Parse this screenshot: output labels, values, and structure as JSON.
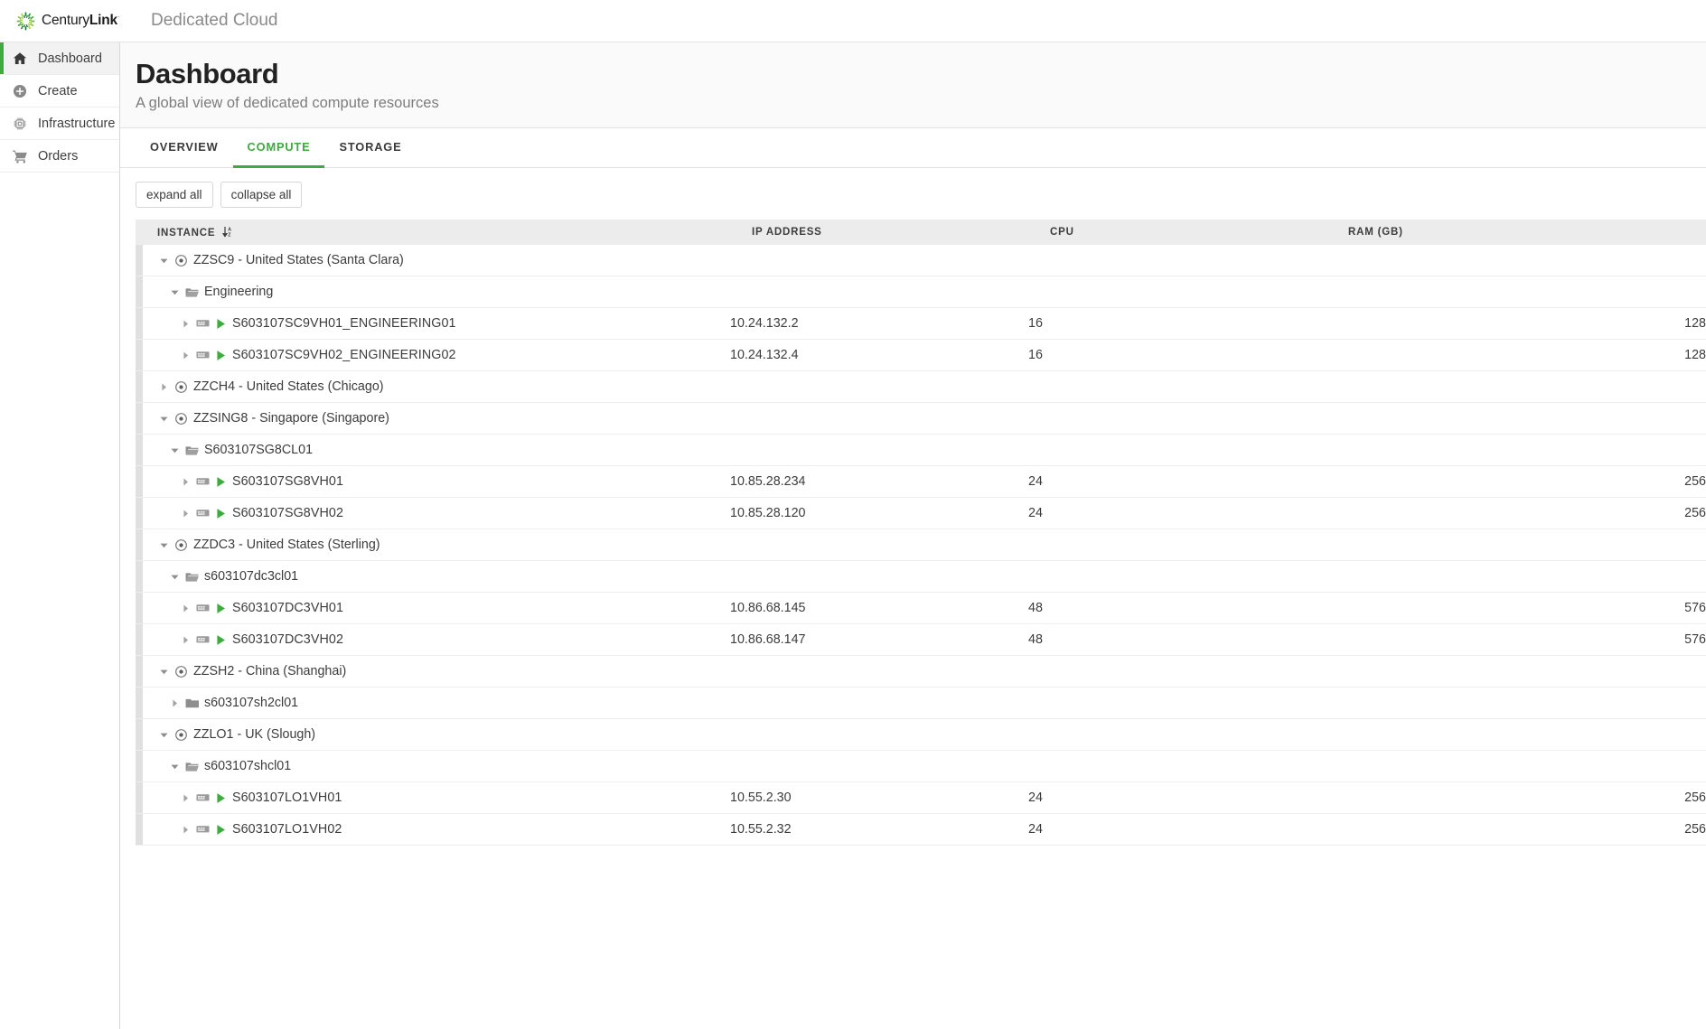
{
  "brand": {
    "name_light": "Century",
    "name_bold": "Link",
    "registered": "·",
    "logo_icon": "centurylink-burst-icon",
    "app_title": "Dedicated Cloud",
    "accent_green": "#3eab3e",
    "logo_green_dark": "#1a7a33",
    "logo_green_mid": "#4aa83c",
    "logo_green_light": "#8cc63f"
  },
  "sidebar": {
    "items": [
      {
        "label": "Dashboard",
        "icon": "home-icon",
        "active": true
      },
      {
        "label": "Create",
        "icon": "plus-circle-icon",
        "active": false
      },
      {
        "label": "Infrastructure",
        "icon": "chip-icon",
        "active": false
      },
      {
        "label": "Orders",
        "icon": "cart-icon",
        "active": false
      }
    ]
  },
  "page": {
    "title": "Dashboard",
    "subtitle": "A global view of dedicated compute resources"
  },
  "tabs": [
    {
      "label": "OVERVIEW",
      "active": false
    },
    {
      "label": "COMPUTE",
      "active": true
    },
    {
      "label": "STORAGE",
      "active": false
    }
  ],
  "toolbar": {
    "expand_all_label": "expand all",
    "collapse_all_label": "collapse all"
  },
  "table": {
    "columns": {
      "instance": "INSTANCE",
      "instance_sort_icon": "sort-az-descending-icon",
      "ip_address": "IP ADDRESS",
      "cpu": "CPU",
      "ram": "RAM (GB)"
    },
    "rows": [
      {
        "level": 0,
        "type": "datacenter",
        "expanded": true,
        "icon": "target-circle-icon",
        "label": "ZZSC9 - United States (Santa Clara)",
        "ip": "",
        "cpu": "",
        "ram": "",
        "gutter": "dark"
      },
      {
        "level": 1,
        "type": "folder",
        "expanded": true,
        "icon": "folder-open-icon",
        "label": "Engineering",
        "ip": "",
        "cpu": "",
        "ram": "",
        "gutter": "dark"
      },
      {
        "level": 2,
        "type": "server",
        "expanded": false,
        "icon": "server-icon",
        "status_icon": "play-running-icon",
        "label": "S603107SC9VH01_ENGINEERING01",
        "ip": "10.24.132.2",
        "cpu": "16",
        "ram": "128",
        "gutter": "dark"
      },
      {
        "level": 2,
        "type": "server",
        "expanded": false,
        "icon": "server-icon",
        "status_icon": "play-running-icon",
        "label": "S603107SC9VH02_ENGINEERING02",
        "ip": "10.24.132.4",
        "cpu": "16",
        "ram": "128",
        "gutter": "dark"
      },
      {
        "level": 0,
        "type": "datacenter",
        "expanded": false,
        "icon": "target-circle-icon",
        "label": "ZZCH4 - United States (Chicago)",
        "ip": "",
        "cpu": "",
        "ram": "",
        "gutter": "dark"
      },
      {
        "level": 0,
        "type": "datacenter",
        "expanded": true,
        "icon": "target-circle-icon",
        "label": "ZZSING8 - Singapore (Singapore)",
        "ip": "",
        "cpu": "",
        "ram": "",
        "gutter": "dark"
      },
      {
        "level": 1,
        "type": "folder",
        "expanded": true,
        "icon": "folder-open-icon",
        "label": "S603107SG8CL01",
        "ip": "",
        "cpu": "",
        "ram": "",
        "gutter": "dark"
      },
      {
        "level": 2,
        "type": "server",
        "expanded": false,
        "icon": "server-icon",
        "status_icon": "play-running-icon",
        "label": "S603107SG8VH01",
        "ip": "10.85.28.234",
        "cpu": "24",
        "ram": "256",
        "gutter": "dark"
      },
      {
        "level": 2,
        "type": "server",
        "expanded": false,
        "icon": "server-icon",
        "status_icon": "play-running-icon",
        "label": "S603107SG8VH02",
        "ip": "10.85.28.120",
        "cpu": "24",
        "ram": "256",
        "gutter": "dark"
      },
      {
        "level": 0,
        "type": "datacenter",
        "expanded": true,
        "icon": "target-circle-icon",
        "label": "ZZDC3 - United States (Sterling)",
        "ip": "",
        "cpu": "",
        "ram": "",
        "gutter": "dark"
      },
      {
        "level": 1,
        "type": "folder",
        "expanded": true,
        "icon": "folder-open-icon",
        "label": "s603107dc3cl01",
        "ip": "",
        "cpu": "",
        "ram": "",
        "gutter": "dark"
      },
      {
        "level": 2,
        "type": "server",
        "expanded": false,
        "icon": "server-icon",
        "status_icon": "play-running-icon",
        "label": "S603107DC3VH01",
        "ip": "10.86.68.145",
        "cpu": "48",
        "ram": "576",
        "gutter": "dark"
      },
      {
        "level": 2,
        "type": "server",
        "expanded": false,
        "icon": "server-icon",
        "status_icon": "play-running-icon",
        "label": "S603107DC3VH02",
        "ip": "10.86.68.147",
        "cpu": "48",
        "ram": "576",
        "gutter": "dark"
      },
      {
        "level": 0,
        "type": "datacenter",
        "expanded": true,
        "icon": "target-circle-icon",
        "label": "ZZSH2 - China (Shanghai)",
        "ip": "",
        "cpu": "",
        "ram": "",
        "gutter": "dark"
      },
      {
        "level": 1,
        "type": "folder",
        "expanded": false,
        "icon": "folder-closed-icon",
        "label": "s603107sh2cl01",
        "ip": "",
        "cpu": "",
        "ram": "",
        "gutter": "dark"
      },
      {
        "level": 0,
        "type": "datacenter",
        "expanded": true,
        "icon": "target-circle-icon",
        "label": "ZZLO1 - UK (Slough)",
        "ip": "",
        "cpu": "",
        "ram": "",
        "gutter": "dark"
      },
      {
        "level": 1,
        "type": "folder",
        "expanded": true,
        "icon": "folder-open-icon",
        "label": "s603107shcl01",
        "ip": "",
        "cpu": "",
        "ram": "",
        "gutter": "dark"
      },
      {
        "level": 2,
        "type": "server",
        "expanded": false,
        "icon": "server-icon",
        "status_icon": "play-running-icon",
        "label": "S603107LO1VH01",
        "ip": "10.55.2.30",
        "cpu": "24",
        "ram": "256",
        "gutter": "dark"
      },
      {
        "level": 2,
        "type": "server",
        "expanded": false,
        "icon": "server-icon",
        "status_icon": "play-running-icon",
        "label": "S603107LO1VH02",
        "ip": "10.55.2.32",
        "cpu": "24",
        "ram": "256",
        "gutter": "dark"
      }
    ]
  }
}
